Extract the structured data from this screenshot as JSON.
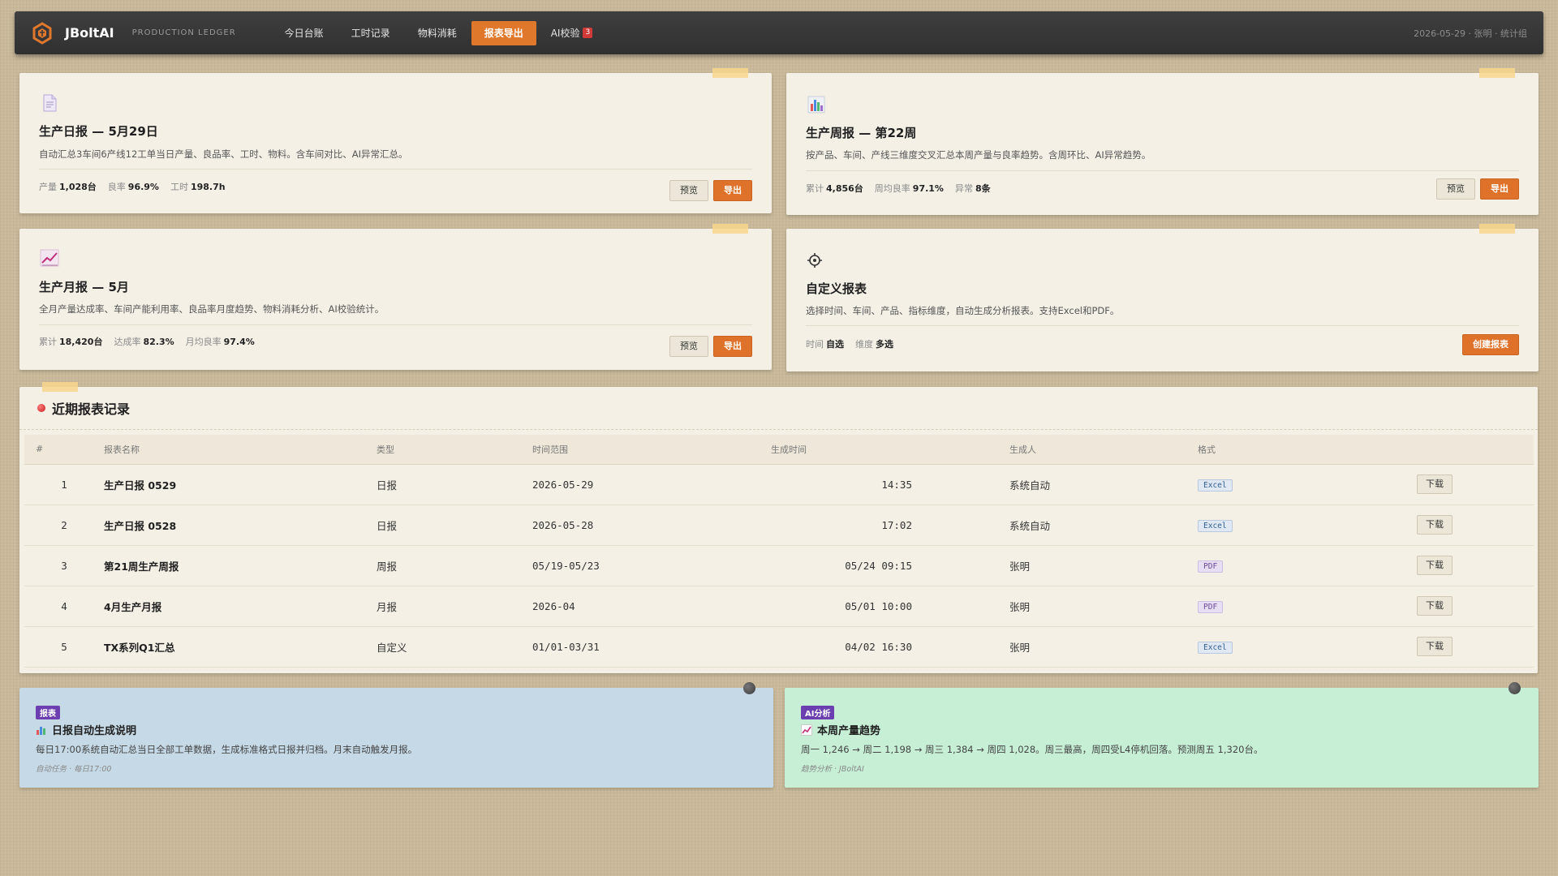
{
  "topbar": {
    "brand": "JBoltAI",
    "subtitle": "PRODUCTION LEDGER",
    "nav": [
      {
        "label": "今日台账"
      },
      {
        "label": "工时记录"
      },
      {
        "label": "物料消耗"
      },
      {
        "label": "报表导出"
      },
      {
        "label": "AI校验",
        "badge": "3"
      }
    ],
    "right_info": "2026-05-29 · 张明 · 统计组"
  },
  "cards": {
    "daily": {
      "icon": "document-icon",
      "title": "生产日报 — 5月29日",
      "desc": "自动汇总3车间6产线12工单当日产量、良品率、工时、物料。含车间对比、AI异常汇总。",
      "stats": [
        {
          "label": "产量",
          "value": "1,028台"
        },
        {
          "label": "良率",
          "value": "96.9%"
        },
        {
          "label": "工时",
          "value": "198.7h"
        }
      ],
      "preview": "预览",
      "export": "导出"
    },
    "weekly": {
      "icon": "bar-chart-icon",
      "title": "生产周报 — 第22周",
      "desc": "按产品、车间、产线三维度交叉汇总本周产量与良率趋势。含周环比、AI异常趋势。",
      "stats": [
        {
          "label": "累计",
          "value": "4,856台"
        },
        {
          "label": "周均良率",
          "value": "97.1%"
        },
        {
          "label": "异常",
          "value": "8条"
        }
      ],
      "preview": "预览",
      "export": "导出"
    },
    "monthly": {
      "icon": "trend-chart-icon",
      "title": "生产月报 — 5月",
      "desc": "全月产量达成率、车间产能利用率、良品率月度趋势、物料消耗分析、AI校验统计。",
      "stats": [
        {
          "label": "累计",
          "value": "18,420台"
        },
        {
          "label": "达成率",
          "value": "82.3%"
        },
        {
          "label": "月均良率",
          "value": "97.4%"
        }
      ],
      "preview": "预览",
      "export": "导出"
    },
    "custom": {
      "icon": "gear-icon",
      "title": "自定义报表",
      "desc": "选择时间、车间、产品、指标维度，自动生成分析报表。支持Excel和PDF。",
      "stats": [
        {
          "label": "时间",
          "value": "自选"
        },
        {
          "label": "维度",
          "value": "多选"
        }
      ],
      "create": "创建报表"
    }
  },
  "records": {
    "title": "近期报表记录",
    "columns": [
      "#",
      "报表名称",
      "类型",
      "时间范围",
      "生成时间",
      "生成人",
      "格式",
      ""
    ],
    "rows": [
      {
        "no": "1",
        "name": "生产日报 0529",
        "type": "日报",
        "range": "2026-05-29",
        "time": "14:35",
        "by": "系统自动",
        "format": "Excel",
        "action": "下载"
      },
      {
        "no": "2",
        "name": "生产日报 0528",
        "type": "日报",
        "range": "2026-05-28",
        "time": "17:02",
        "by": "系统自动",
        "format": "Excel",
        "action": "下载"
      },
      {
        "no": "3",
        "name": "第21周生产周报",
        "type": "周报",
        "range": "05/19-05/23",
        "time": "05/24 09:15",
        "by": "张明",
        "format": "PDF",
        "action": "下载"
      },
      {
        "no": "4",
        "name": "4月生产月报",
        "type": "月报",
        "range": "2026-04",
        "time": "05/01 10:00",
        "by": "张明",
        "format": "PDF",
        "action": "下载"
      },
      {
        "no": "5",
        "name": "TX系列Q1汇总",
        "type": "自定义",
        "range": "01/01-03/31",
        "time": "04/02 16:30",
        "by": "张明",
        "format": "Excel",
        "action": "下载"
      }
    ]
  },
  "notes": {
    "left": {
      "badge": "报表",
      "title": "日报自动生成说明",
      "text": "每日17:00系统自动汇总当日全部工单数据，生成标准格式日报并归档。月末自动触发月报。",
      "foot": "自动任务 · 每日17:00"
    },
    "right": {
      "badge": "AI分析",
      "title": "本周产量趋势",
      "text": "周一 1,246 → 周二 1,198 → 周三 1,384 → 周四 1,028。周三最高，周四受L4停机回落。预测周五 1,320台。",
      "foot": "趋势分析 · JBoltAI"
    }
  },
  "colors": {
    "accent": "#df722a",
    "topbar": "#363636",
    "background": "#c9b99a",
    "card": "#f5f0e6"
  }
}
